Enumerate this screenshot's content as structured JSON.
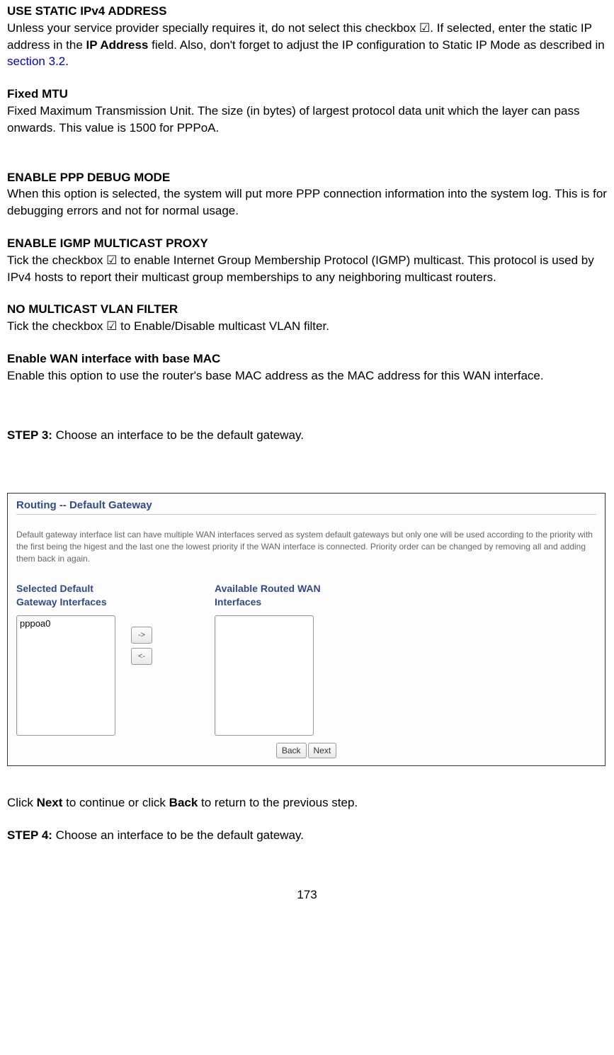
{
  "sections": {
    "s1_heading": "USE STATIC IPv4 ADDRESS",
    "s1_text_a": "Unless your service provider specially requires it, do not select this checkbox ☑.   If selected, enter the static IP address in the ",
    "s1_bold_a": "IP Address",
    "s1_text_b": " field. Also, don't forget to adjust the IP configuration to Static IP Mode as described in ",
    "s1_link": "section 3.2",
    "s1_text_c": ".",
    "s2_heading": "Fixed MTU",
    "s2_text": "Fixed Maximum Transmission Unit. The size (in bytes) of largest protocol data unit which the layer can pass onwards. This value is 1500 for PPPoA.",
    "s3_heading": "ENABLE PPP DEBUG MODE",
    "s3_text": "When this option is selected, the system will put more PPP connection information into the system log. This is for debugging errors and not for normal usage.",
    "s4_heading": "ENABLE IGMP MULTICAST PROXY",
    "s4_text": "Tick the checkbox ☑ to enable Internet Group Membership Protocol (IGMP) multicast. This protocol is used by IPv4 hosts to report their multicast group memberships to any neighboring multicast routers.",
    "s5_heading": "NO MULTICAST VLAN FILTER",
    "s5_text": "Tick the checkbox ☑ to Enable/Disable multicast VLAN filter.",
    "s6_heading": "Enable WAN interface with base MAC",
    "s6_text": "Enable this option to use the router's base MAC address as the MAC address for this WAN interface.",
    "step3_label": "STEP 3:",
    "step3_text": " Choose an interface to be the default gateway.",
    "after_shot_a": "Click ",
    "after_shot_next": "Next",
    "after_shot_b": " to continue or click ",
    "after_shot_back": "Back",
    "after_shot_c": " to return to the previous step.",
    "step4_label": "STEP 4:",
    "step4_text": "  Choose an interface to be the default gateway.",
    "page_number": "173"
  },
  "screenshot": {
    "title": "Routing -- Default Gateway",
    "description": "Default gateway interface list can have multiple WAN interfaces served as system default gateways but only one will be used according to the priority with the first being the higest and the last one the lowest priority if the WAN interface is connected. Priority order can be changed by removing all and adding them back in again.",
    "selected_label": "Selected Default Gateway Interfaces",
    "available_label": "Available Routed WAN Interfaces",
    "selected_item": "pppoa0",
    "move_right": "->",
    "move_left": "<-",
    "back_btn": "Back",
    "next_btn": "Next"
  }
}
